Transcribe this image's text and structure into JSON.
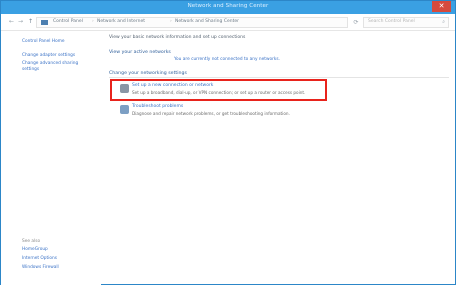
{
  "window": {
    "title": "Network and Sharing Center",
    "close_label": "✕"
  },
  "address": {
    "back_label": "←",
    "forward_label": "→",
    "up_label": "↑",
    "crumbs": [
      "Control Panel",
      "Network and Internet",
      "Network and Sharing Center"
    ],
    "separator": "›",
    "refresh_label": "⟳",
    "search_placeholder": "Search Control Panel",
    "search_icon_glyph": "⌕"
  },
  "sidebar": {
    "links": [
      "Control Panel Home",
      "Change adapter settings",
      "Change advanced sharing",
      "settings"
    ],
    "see_also_title": "See also",
    "see_also": [
      "HomeGroup",
      "Internet Options",
      "Windows Firewall"
    ]
  },
  "main": {
    "intro": "View your basic network information and set up connections",
    "active_title": "View your active networks",
    "active_link": "You are currently not connected to any networks.",
    "change_title": "Change your networking settings",
    "items": [
      {
        "title": "Set up a new connection or network",
        "desc": "Set up a broadband, dial-up, or VPN connection; or set up a router or access point."
      },
      {
        "title": "Troubleshoot problems",
        "desc": "Diagnose and repair network problems, or get troubleshooting information."
      }
    ]
  },
  "colors": {
    "titlebar": "#3aa0e3",
    "link": "#3a72c6",
    "highlight": "#e8231c",
    "close": "#d64a3d"
  }
}
